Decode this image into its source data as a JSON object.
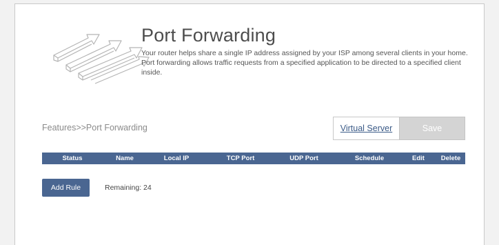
{
  "header": {
    "title": "Port Forwarding",
    "description": "Your router helps share a single IP address assigned by your ISP among several clients in your home. Port forwarding allows traffic requests from a specified application to be directed to a specified client inside."
  },
  "hero_icon": "port-forwarding-arrows-icon",
  "breadcrumb": "Features>>Port Forwarding",
  "actions": {
    "virtual_server_label": "Virtual Server",
    "save_label": "Save"
  },
  "table": {
    "columns": [
      "Status",
      "Name",
      "Local IP",
      "TCP Port",
      "UDP Port",
      "Schedule",
      "Edit",
      "Delete"
    ],
    "rows": []
  },
  "footer": {
    "add_rule_label": "Add Rule",
    "remaining_label": "Remaining:",
    "remaining_count": "24"
  },
  "colors": {
    "accent": "#4a6691",
    "link": "#3a5a87",
    "disabled_button": "#d4d4d4"
  }
}
